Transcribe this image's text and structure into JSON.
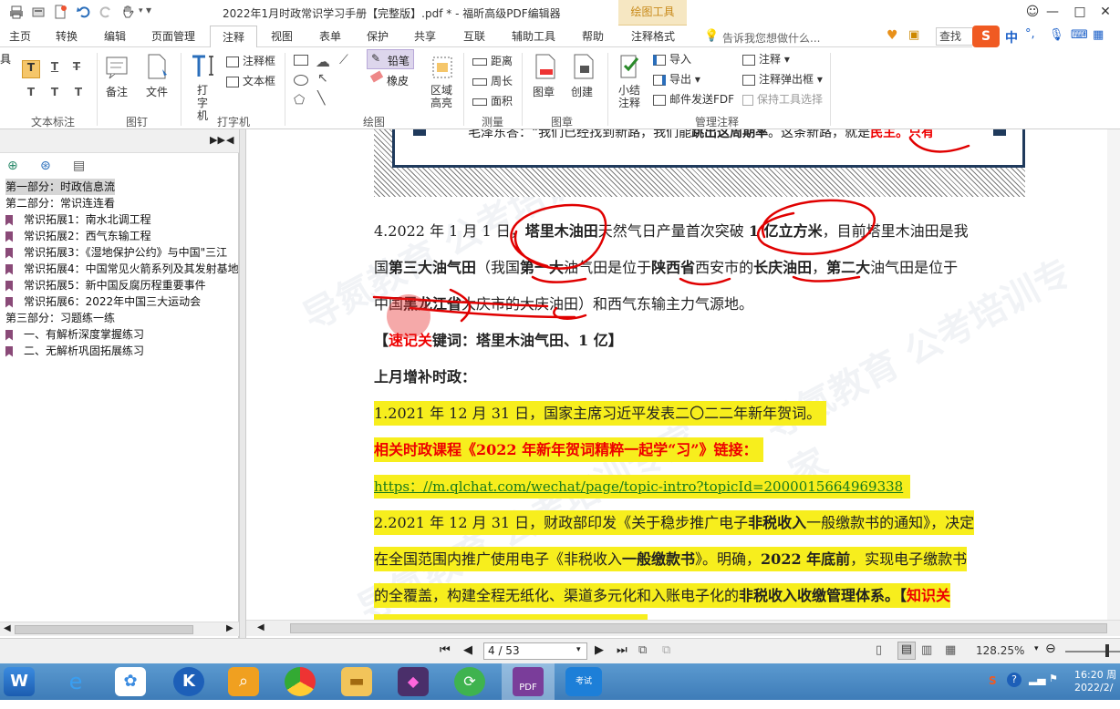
{
  "window": {
    "title": "2022年1月时政常识学习手册【完整版】.pdf * - 福昕高级PDF编辑器",
    "context_tab": "绘图工具",
    "search_placeholder": "查找",
    "tell_me": "告诉我您想做什么..."
  },
  "menu_tabs": [
    "主页",
    "转换",
    "编辑",
    "页面管理",
    "注释",
    "视图",
    "表单",
    "保护",
    "共享",
    "互联",
    "辅助工具",
    "帮助",
    "注释格式"
  ],
  "ribbon": {
    "groups": [
      "文本标注",
      "图钉",
      "打字机",
      "绘图",
      "测量",
      "图章",
      "管理注释"
    ],
    "pin_note": "备注",
    "pin_file": "文件",
    "typewriter": "打字机",
    "annot_box": "注释框",
    "text_box": "文本框",
    "pencil": "铅笔",
    "eraser": "橡皮",
    "area_highlight": "区域高亮",
    "distance": "距离",
    "perimeter": "周长",
    "area": "面积",
    "stamp": "图章",
    "create": "创建",
    "summary": "小结注释",
    "import": "导入",
    "export": "导出",
    "email_fdf": "邮件发送FDF",
    "comment": "注释",
    "comment_popup": "注释弹出框",
    "keep_tool": "保持工具选择"
  },
  "bookmarks": [
    {
      "label": "第一部分：时政信息流",
      "level": 0,
      "selected": true
    },
    {
      "label": "第二部分：常识连连看",
      "level": 0,
      "selected": false
    },
    {
      "label": "常识拓展1：南水北调工程",
      "level": 1,
      "selected": false
    },
    {
      "label": "常识拓展2：西气东输工程",
      "level": 1,
      "selected": false
    },
    {
      "label": "常识拓展3：《湿地保护公约》与中国\"三江",
      "level": 1,
      "selected": false
    },
    {
      "label": "常识拓展4：中国常见火箭系列及其发射基地",
      "level": 1,
      "selected": false
    },
    {
      "label": "常识拓展5：新中国反腐历程重要事件",
      "level": 1,
      "selected": false
    },
    {
      "label": "常识拓展6：2022年中国三大运动会",
      "level": 1,
      "selected": false
    },
    {
      "label": "第三部分：习题练一练",
      "level": 0,
      "selected": false
    },
    {
      "label": "一、有解析深度掌握练习",
      "level": 1,
      "selected": false
    },
    {
      "label": "二、无解析巩固拓展练习",
      "level": 1,
      "selected": false
    }
  ],
  "document": {
    "quote_a": "毛泽东答：“我们已经找到新路，我们能",
    "quote_b": "跳出这周期率",
    "quote_c": "。这条新路，就是",
    "quote_d": "民主",
    "quote_e": "。只有",
    "p4_a": "4.2022 年 1 月 1 日，",
    "p4_b": "塔里木油田",
    "p4_c": "天然气日产量首次突破 ",
    "p4_d": "1 亿立方米",
    "p4_e": "，目前塔里木油田是我",
    "p4l2_a": "国",
    "p4l2_b": "第三大油气田",
    "p4l2_c": "（我国",
    "p4l2_d": "第一大",
    "p4l2_e": "油气田是位于",
    "p4l2_f": "陕西省",
    "p4l2_g": "西安市的",
    "p4l2_h": "长庆油田",
    "p4l2_i": "，",
    "p4l2_j": "第二大",
    "p4l2_k": "油气田是位于",
    "p4l3_a": "中国",
    "p4l3_b": "黑龙江省",
    "p4l3_c": "大庆市的大庆油田）和西气东输主力气源地。",
    "keyword_a": "【",
    "keyword_b": "速记关",
    "keyword_c": "键词：塔里木油气田、1 亿】",
    "section": "上月增补时政：",
    "item1": "1.2021 年  12 月 31 日，国家主席习近平发表二〇二二年新年贺词。",
    "course": "相关时政课程《2022 年新年贺词精粹一起学“习”》链接：",
    "link": "https：//m.qlchat.com/wechat/page/topic-intro?topicId=2000015664969338",
    "item2_l1_a": "2.2021 年 12 月 31 日，财政部印发《关于稳步推广电子",
    "item2_l1_b": "非税收入",
    "item2_l1_c": "一般缴款书的通知》，决定",
    "item2_l2_a": "在全国范围内推广使用电子《非税收入",
    "item2_l2_b": "一般缴款书",
    "item2_l2_c": "》。明确，",
    "item2_l2_d": "2022 年底前",
    "item2_l2_e": "，实现电子缴款书",
    "item2_l3_a": "的全覆盖，构建全程无纸化、渠道多元化和入账电子化的",
    "item2_l3_b": "非税收入收缴管理体系",
    "item2_l3_c": "。【",
    "item2_l3_d": "知识关"
  },
  "watermark": "导氮教育 公考培训专家",
  "status": {
    "page": "4 / 53",
    "zoom": "128.25%"
  },
  "tray": {
    "time": "16:20 周",
    "date": "2022/2/"
  },
  "colors": {
    "accent": "#c88a1a",
    "highlight": "#f7ee1d",
    "ink": "#e00000",
    "bookmark": "#8a4a78"
  }
}
